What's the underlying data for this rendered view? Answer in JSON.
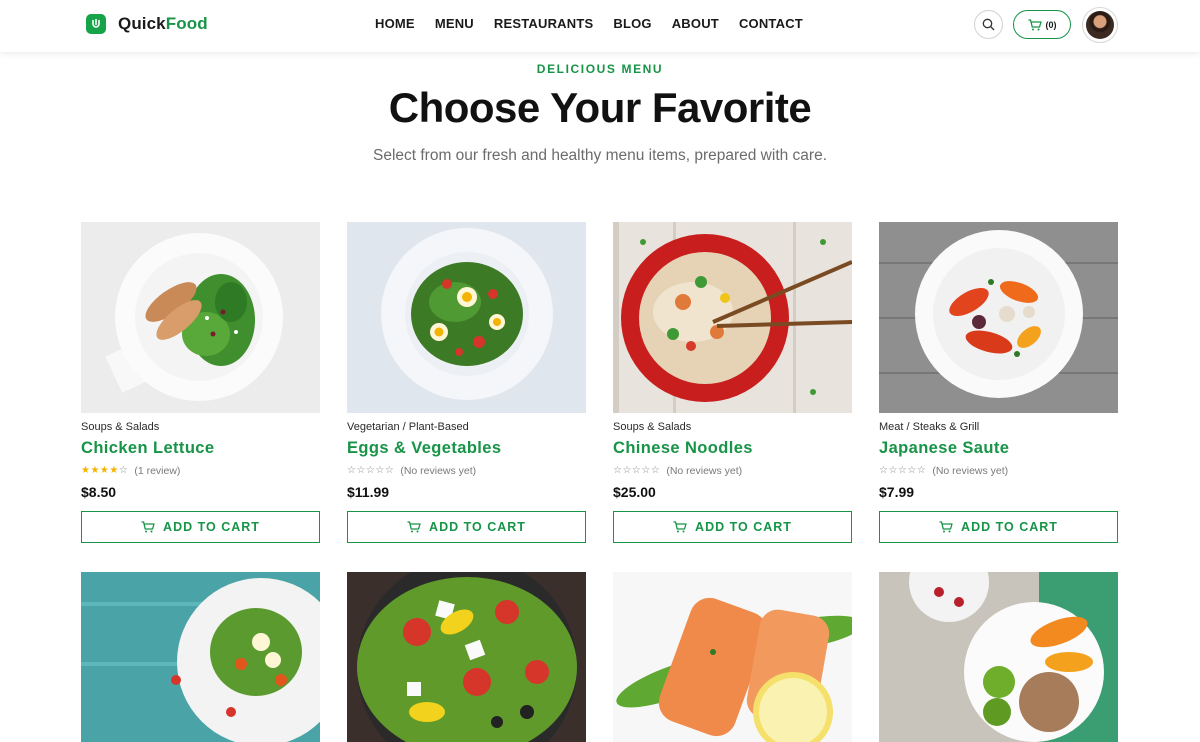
{
  "brand": {
    "name_part1": "Quick",
    "name_part2": "Food",
    "accent": "#179447"
  },
  "nav": {
    "items": [
      {
        "label": "HOME"
      },
      {
        "label": "MENU"
      },
      {
        "label": "RESTAURANTS"
      },
      {
        "label": "BLOG"
      },
      {
        "label": "ABOUT"
      },
      {
        "label": "CONTACT"
      }
    ]
  },
  "header_actions": {
    "cart_count": "(0)",
    "search_icon": "search-icon",
    "cart_icon": "cart-icon"
  },
  "hero": {
    "eyebrow": "DELICIOUS MENU",
    "title": "Choose Your Favorite",
    "subtitle": "Select from our fresh and healthy menu items, prepared with care."
  },
  "products": [
    {
      "category": "Soups & Salads",
      "name": "Chicken Lettuce",
      "rating": 4,
      "reviews": "(1 review)",
      "price": "$8.50",
      "button": "ADD TO CART"
    },
    {
      "category": "Vegetarian / Plant-Based",
      "name": "Eggs & Vegetables",
      "rating": 0,
      "reviews": "(No reviews yet)",
      "price": "$11.99",
      "button": "ADD TO CART"
    },
    {
      "category": "Soups & Salads",
      "name": "Chinese Noodles",
      "rating": 0,
      "reviews": "(No reviews yet)",
      "price": "$25.00",
      "button": "ADD TO CART"
    },
    {
      "category": "Meat / Steaks & Grill",
      "name": "Japanese Saute",
      "rating": 0,
      "reviews": "(No reviews yet)",
      "price": "$7.99",
      "button": "ADD TO CART"
    }
  ]
}
